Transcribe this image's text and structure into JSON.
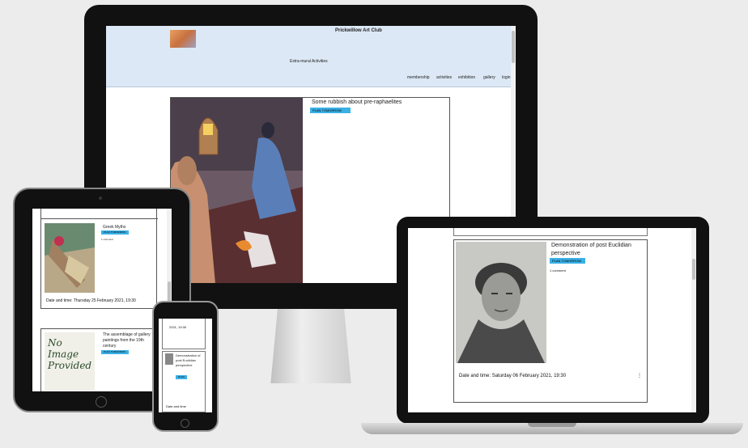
{
  "site": {
    "title": "Prickwillow Art Club",
    "subtitle": "Extra-mural Activities",
    "nav": [
      "membership",
      "activities",
      "exhibition",
      "gallery",
      "login"
    ]
  },
  "desktop": {
    "post_title": "Some rubbish about pre-raphaelites",
    "tag": "PLAN TOMORROW"
  },
  "tablet": {
    "post1_title": "Greek Myths",
    "post1_tag": "PLAN TOMORROW",
    "post1_meta": "1 comment",
    "post1_date": "Date and time: Thursday 25 February 2021, 19:30",
    "post2_title": "The assemblage of gallery paintings from the 19th century",
    "post2_tag": "PLAN TOMORROW",
    "no_image_text": "No Image Provided"
  },
  "phone": {
    "date_fragment": "2021, 19:30",
    "post_title": "Demonstration of post Euclidian perspective",
    "tag": "PLAN",
    "footer_text": "Date and time"
  },
  "laptop": {
    "post_title": "Demonstration of post Euclidian perspective",
    "tag": "PLAN TOMORROW",
    "meta": "1 comment",
    "date": "Date and time: Saturday 06 February 2021, 19:30"
  },
  "colors": {
    "header_bg": "#dce8f5",
    "tag_bg": "#3ab0e5",
    "bezel": "#111111",
    "background": "#ececec"
  }
}
